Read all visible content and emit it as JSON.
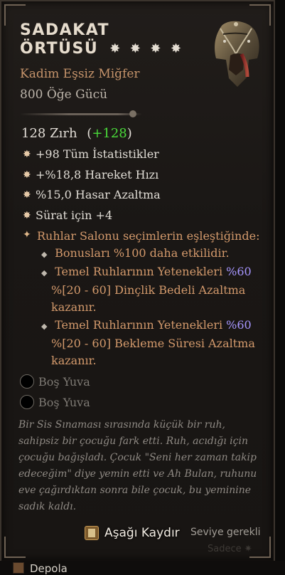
{
  "item": {
    "name_line1": "SADAKAT",
    "name_line2": "ÖRTÜSÜ",
    "stars": [
      "✸",
      "✸",
      "✸",
      "✸"
    ],
    "type": "Kadim Eşsiz Miğfer",
    "power": "800 Öğe Gücü"
  },
  "armor": {
    "base": "128 Zırh",
    "bonus_open": "(",
    "bonus": "+128",
    "bonus_close": ")"
  },
  "stats": [
    {
      "bullet": "✸",
      "text": "+98 Tüm İstatistikler"
    },
    {
      "bullet": "✸",
      "text": "+%18,8 Hareket Hızı"
    },
    {
      "bullet": "✸",
      "text": "%15,0 Hasar Azaltma"
    },
    {
      "bullet": "✸",
      "text": "Sürat için +4"
    }
  ],
  "aspect": {
    "bullet": "✦",
    "text": "Ruhlar Salonu seçimlerin eşleştiğinde:",
    "subs": [
      {
        "bullet": "◆",
        "line1": "Bonusları %100 daha etkilidir."
      },
      {
        "bullet": "◆",
        "line1_a": "Temel Ruhlarının Yetenekleri ",
        "line1_b": "%60",
        "line2": "%[20 - 60] Dinçlik Bedeli Azaltma",
        "line3": "kazanır."
      },
      {
        "bullet": "◆",
        "line1_a": "Temel Ruhlarının Yetenekleri ",
        "line1_b": "%60",
        "line2": "%[20 - 60] Bekleme Süresi Azaltma",
        "line3": "kazanır."
      }
    ]
  },
  "sockets": [
    {
      "label": "Boş Yuva"
    },
    {
      "label": "Boş Yuva"
    }
  ],
  "flavor": "Bir Sis Sınaması sırasında küçük bir ruh, sahipsiz bir çocuğu fark etti. Ruh, acıdığı için çocuğu bağışladı. Çocuk \"Seni her zaman takip edeceğim\" diye yemin etti ve Ah Bulan, ruhunu eve çağırdıktan sonra bile çocuk, bu yeminine sadık kaldı.",
  "footer": {
    "scroll_label": "Aşağı Kaydır",
    "req_label": "Seviye gerekli",
    "req2_label": "Sadece"
  },
  "depot": {
    "label": "Depola"
  },
  "colors": {
    "accent": "#d49a6c",
    "bonus": "#4adb3a",
    "percent": "#a796ff"
  }
}
